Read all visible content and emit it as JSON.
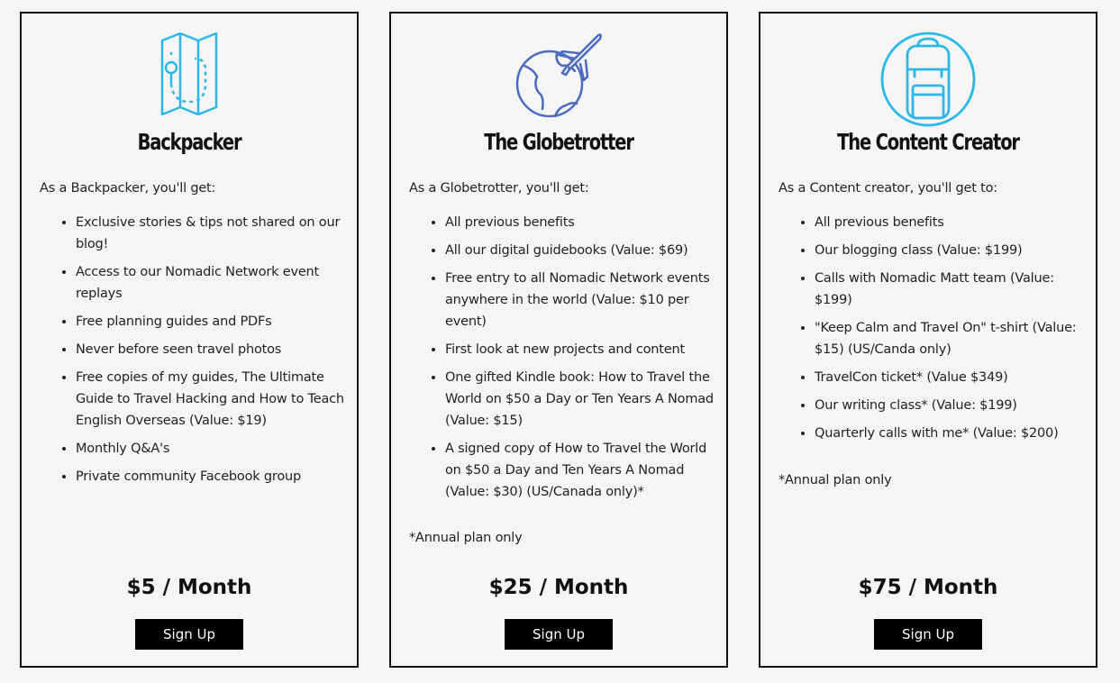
{
  "colors": {
    "icon_cyan": "#2bb8e6",
    "icon_blue": "#4a6bbf",
    "button_bg": "#000000",
    "border": "#111111"
  },
  "plans": [
    {
      "icon": "folded-map-icon",
      "title": "Backpacker",
      "intro": "As a Backpacker, you'll get:",
      "benefits": [
        "Exclusive stories & tips not shared on our blog!",
        "Access to our Nomadic Network event replays",
        "Free planning guides and PDFs",
        "Never before seen travel photos",
        "Free copies of my guides, The Ultimate Guide to Travel Hacking and How to Teach English Overseas (Value: $19)",
        "Monthly Q&A's",
        "Private community Facebook group"
      ],
      "footnote": "",
      "price": "$5 / Month",
      "button_label": "Sign Up"
    },
    {
      "icon": "globe-airplane-icon",
      "title": "The Globetrotter",
      "intro": "As a Globetrotter, you'll get:",
      "benefits": [
        "All previous benefits",
        "All our digital guidebooks (Value: $69)",
        "Free entry to all Nomadic Network events anywhere in the world (Value: $10 per event)",
        "First look at new projects and content",
        "One gifted Kindle book: How to Travel the World on $50 a Day or Ten Years A Nomad (Value: $15)",
        "A signed copy of How to Travel the World on $50 a Day and Ten Years A Nomad (Value: $30) (US/Canada only)*"
      ],
      "footnote": "*Annual plan only",
      "price": "$25 / Month",
      "button_label": "Sign Up"
    },
    {
      "icon": "backpack-icon",
      "title": "The Content Creator",
      "intro": "As a Content creator, you'll get to:",
      "benefits": [
        "All previous benefits",
        "Our blogging class (Value: $199)",
        "Calls with Nomadic Matt team (Value: $199)",
        "\"Keep Calm and Travel On\" t-shirt (Value: $15) (US/Canda only)",
        "TravelCon ticket* (Value $349)",
        "Our writing class* (Value: $199)",
        "Quarterly calls with me* (Value: $200)"
      ],
      "footnote": "*Annual plan only",
      "price": "$75 / Month",
      "button_label": "Sign Up"
    }
  ]
}
